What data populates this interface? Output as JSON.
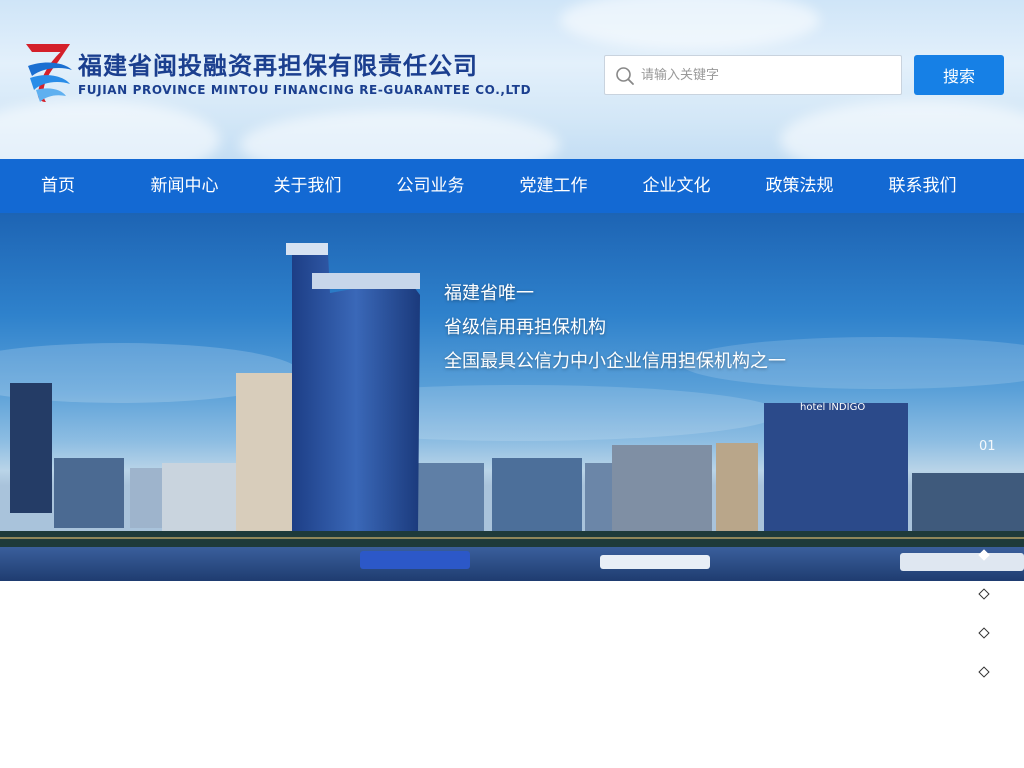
{
  "header": {
    "company_cn": "福建省闽投融资再担保有限责任公司",
    "company_en": "FUJIAN PROVINCE MINTOU FINANCING RE-GUARANTEE CO.,LTD",
    "search_placeholder": "请输入关键字",
    "search_button": "搜索",
    "brand_color": "#1b3f8f",
    "search_button_color": "#1680e6"
  },
  "nav": {
    "color": "#1369d3",
    "items": [
      "首页",
      "新闻中心",
      "关于我们",
      "公司业务",
      "党建工作",
      "企业文化",
      "政策法规",
      "联系我们"
    ]
  },
  "banner": {
    "slogans": [
      "福建省唯一",
      "省级信用再担保机构",
      "全国最具公信力中小企业信用担保机构之一"
    ],
    "slide_number": "01",
    "pager_count": 4,
    "active_index": 0,
    "building_sign": "hotel INDIGO"
  }
}
